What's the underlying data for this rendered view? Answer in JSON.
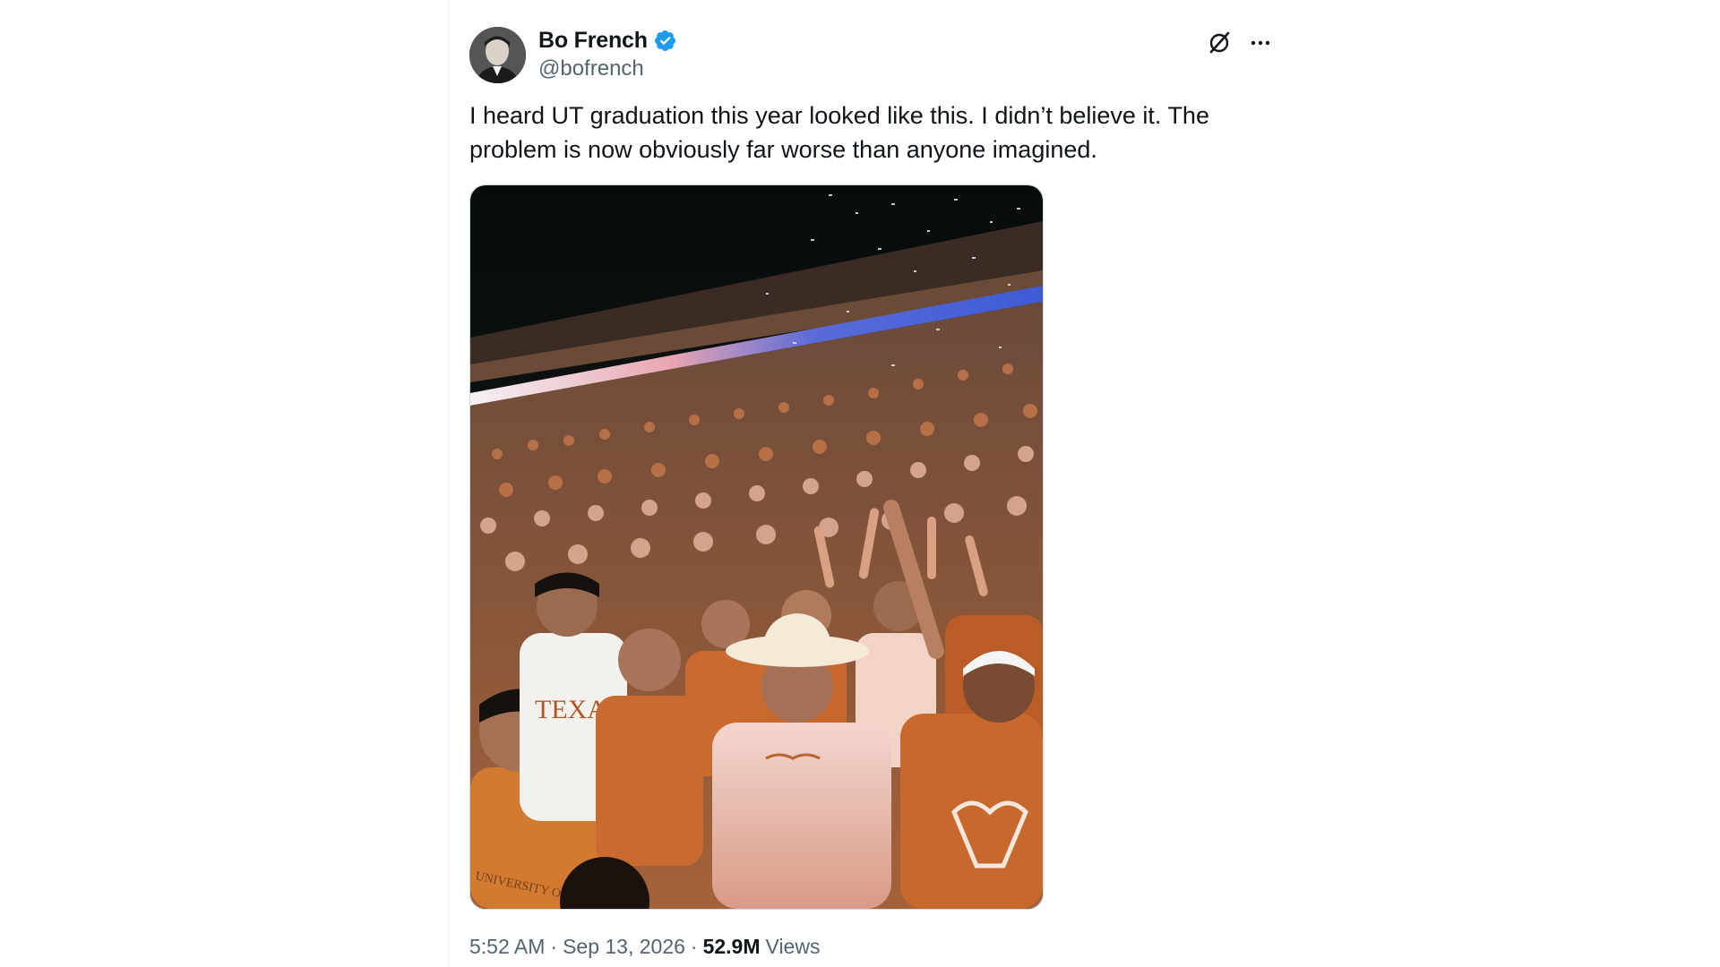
{
  "author": {
    "display_name": "Bo French",
    "handle": "@bofrench",
    "verified": true,
    "verified_color": "#1d9bf0"
  },
  "tweet": {
    "text": "I heard UT graduation this year looked like this. I didn’t believe it. The problem is now obviously far worse than anyone imagined.",
    "time": "5:52 AM",
    "date": "Sep 13, 2026",
    "views_count": "52.9M",
    "views_label": "Views",
    "separator": "·"
  },
  "media": {
    "description_icon": "photo-icon",
    "shirt_text_1": "TEXAS",
    "shirt_text_2": "UNIVERSITY OF"
  },
  "icons": {
    "grok": "grok-icon",
    "more": "more-icon",
    "verified": "verified-badge-icon"
  },
  "colors": {
    "text_primary": "#0f1419",
    "text_secondary": "#536471",
    "burnt_orange": "#bf5700"
  }
}
